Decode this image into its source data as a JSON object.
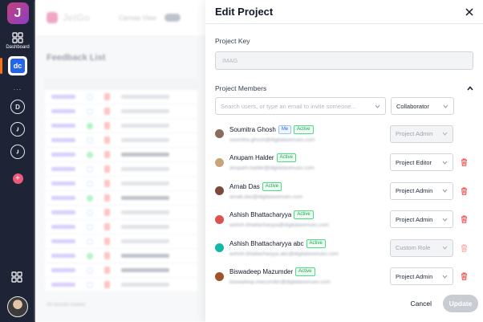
{
  "rail": {
    "logo_letter": "J",
    "dashboard_label": "Dashboard",
    "app_badge": "dc",
    "dots": "...",
    "circle_items": [
      "D",
      "",
      ""
    ],
    "plus": "+"
  },
  "background": {
    "brand": "JetGo",
    "canvas_view_label": "Canvas View",
    "page_title": "Feedback List",
    "footer_text": "All records loaded"
  },
  "drawer": {
    "title": "Edit Project",
    "project_key_label": "Project Key",
    "project_key_value": "IMAG",
    "members_label": "Project Members",
    "invite_placeholder": "Search users, or type an email to invite someone...",
    "invite_role": "Collaborator",
    "members": [
      {
        "name": "Soumitra Ghosh",
        "me": "Me",
        "status": "Active",
        "email": "soumitra.ghosh@digitalavenues.com",
        "role": "Project Admin",
        "avatar_color": "#8b6b5c"
      },
      {
        "name": "Anupam Halder",
        "status": "Active",
        "email": "anupam.halder@digitalavenues.com",
        "role": "Project Editor",
        "avatar_color": "#c9a47a"
      },
      {
        "name": "Arnab Das",
        "status": "Active",
        "email": "arnab.das@digitalavenues.com",
        "role": "Project Admin",
        "avatar_color": "#7c4a3a"
      },
      {
        "name": "Ashish Bhattacharyya",
        "status": "Active",
        "email": "ashish.bhattacharyya@digitalavenues.com",
        "role": "Project Admin",
        "avatar_color": "#d9534f"
      },
      {
        "name": "Ashish Bhattacharyya abc",
        "status": "Active",
        "email": "ashish.bhattacharyya.abc@digitalavenues.com",
        "role": "Custom Role",
        "avatar_color": "#14b8a6"
      },
      {
        "name": "Biswadeep Mazumder",
        "status": "Active",
        "email": "biswadeep.mazumder@digitalavenues.com",
        "role": "Project Admin",
        "avatar_color": "#a0522d"
      }
    ],
    "cancel_label": "Cancel",
    "update_label": "Update"
  },
  "colors": {
    "rail_bg": "#1e2436",
    "active_green": "#16a34a",
    "me_blue": "#2563eb",
    "trash_red": "#ef4444"
  },
  "icons": [
    "grid-icon",
    "close-icon",
    "chevron-up-icon",
    "chevron-down-icon",
    "trash-icon"
  ]
}
